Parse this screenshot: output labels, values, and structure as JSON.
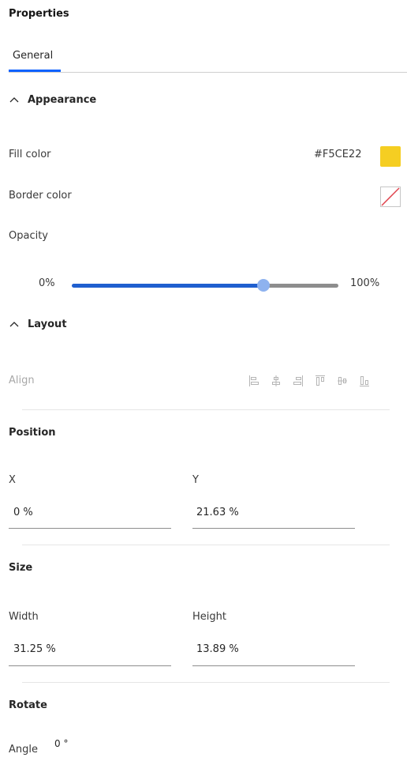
{
  "panel": {
    "title": "Properties"
  },
  "tabs": [
    {
      "label": "General",
      "active": true
    }
  ],
  "appearance": {
    "header": "Appearance",
    "fill_color": {
      "label": "Fill color",
      "value": "#F5CE22",
      "swatch": "#F5CE22"
    },
    "border_color": {
      "label": "Border color",
      "swatch_icon": "no-color-icon"
    },
    "opacity": {
      "label": "Opacity",
      "min_label": "0%",
      "max_label": "100%",
      "value_fraction": 0.72
    }
  },
  "layout": {
    "header": "Layout",
    "align": {
      "label": "Align",
      "icons": [
        "align-left-icon",
        "align-center-icon",
        "align-right-icon",
        "align-top-icon",
        "align-middle-icon",
        "align-bottom-icon"
      ]
    },
    "position": {
      "header": "Position",
      "x": {
        "label": "X",
        "value": "0 %"
      },
      "y": {
        "label": "Y",
        "value": "21.63 %"
      }
    },
    "size": {
      "header": "Size",
      "width": {
        "label": "Width",
        "value": "31.25 %"
      },
      "height": {
        "label": "Height",
        "value": "13.89 %"
      }
    },
    "rotate": {
      "header": "Rotate",
      "angle": {
        "label": "Angle",
        "value": "0 °"
      }
    }
  },
  "colors": {
    "accent": "#0f62fe",
    "slider_fill": "#1f5fcf",
    "slider_rest": "#8d8d8d"
  }
}
